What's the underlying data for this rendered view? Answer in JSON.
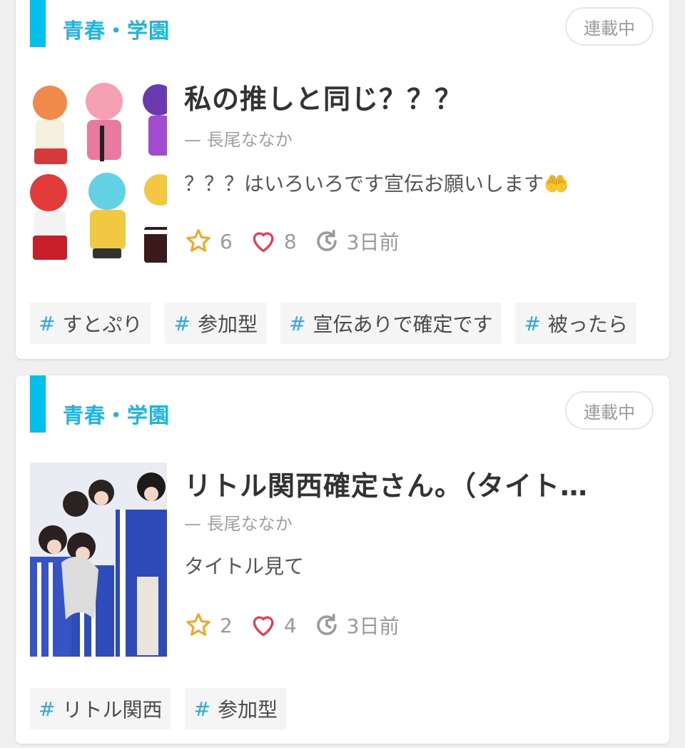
{
  "accent_color": "#00c0ee",
  "cards": [
    {
      "genre": "青春・学園",
      "status": "連載中",
      "title": "私の推しと同じ？？？",
      "author": "— 長尾ななか",
      "description": "？？？はいろいろです宣伝お願いします🤲",
      "stars": "6",
      "likes": "8",
      "updated": "3日前",
      "tags": [
        "すとぷり",
        "参加型",
        "宣伝ありで確定です",
        "被ったら"
      ],
      "thumbnail_icon": "chibi-characters-illustration"
    },
    {
      "genre": "青春・学園",
      "status": "連載中",
      "title": "リトル関西確定さん。（タイト…",
      "author": "— 長尾ななか",
      "description": "タイトル見て",
      "stars": "2",
      "likes": "4",
      "updated": "3日前",
      "tags": [
        "リトル関西",
        "参加型"
      ],
      "thumbnail_icon": "group-photo"
    }
  ],
  "icons": {
    "star": "star-icon",
    "heart": "heart-icon",
    "clock": "history-clock-icon",
    "tag": "hashtag-icon"
  }
}
